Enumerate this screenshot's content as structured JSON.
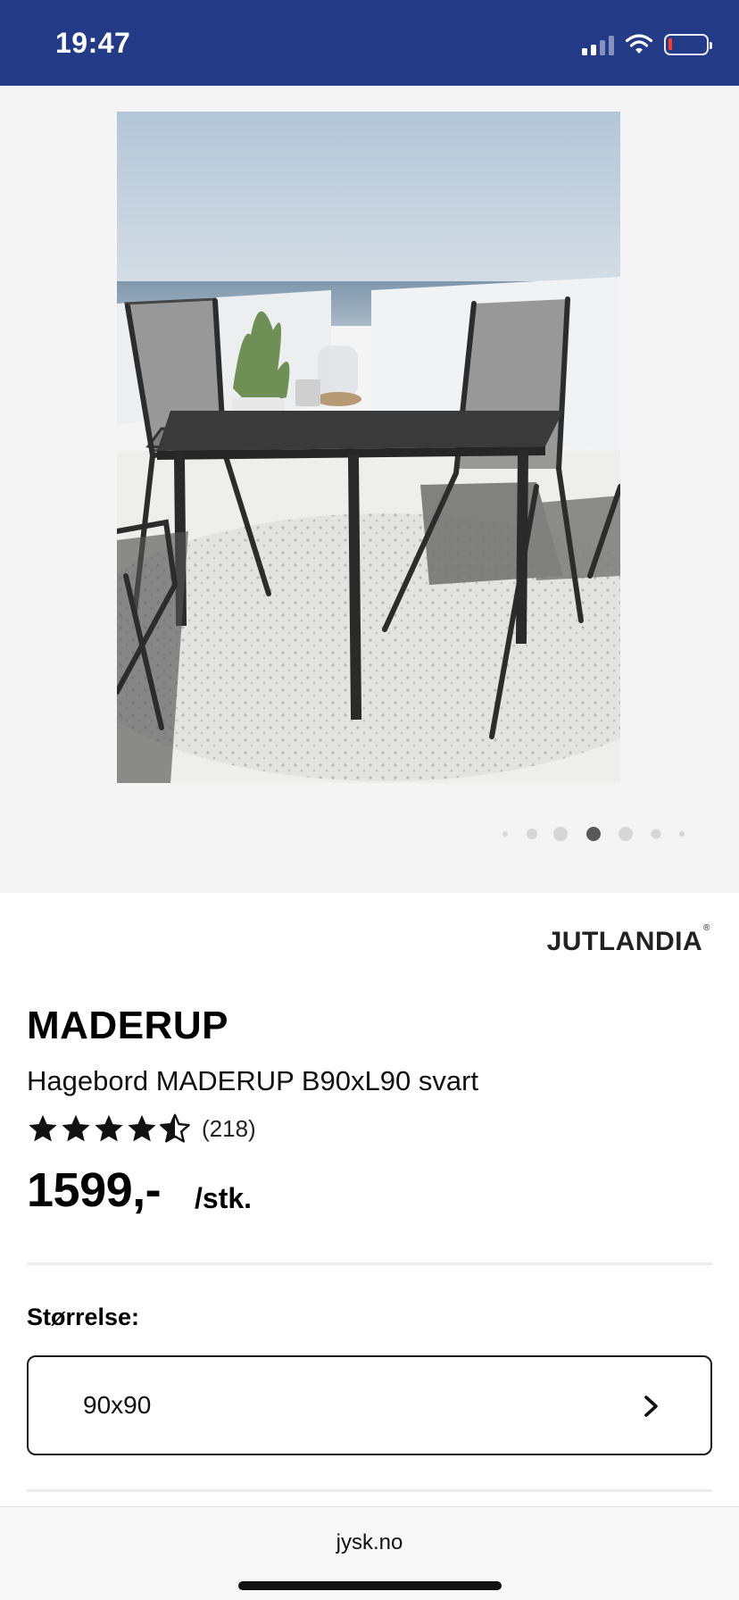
{
  "status_bar": {
    "time": "19:47",
    "background": "#233a87",
    "icons": [
      "signal-icon",
      "wifi-icon",
      "battery-icon"
    ]
  },
  "gallery": {
    "image_count": 7,
    "active_index": 3,
    "background": "#f4f4f4"
  },
  "product": {
    "brand": "JUTLANDIA",
    "brand_mark": "®",
    "name": "MADERUP",
    "subtitle": "Hagebord MADERUP B90xL90 svart",
    "rating": 4.5,
    "rating_max": 5,
    "rating_count": "(218)",
    "price": "1599,-",
    "price_unit": "/stk."
  },
  "size_selector": {
    "label": "Størrelse:",
    "selected": "90x90",
    "icon": "chevron-right-icon"
  },
  "browser": {
    "url": "jysk.no"
  }
}
